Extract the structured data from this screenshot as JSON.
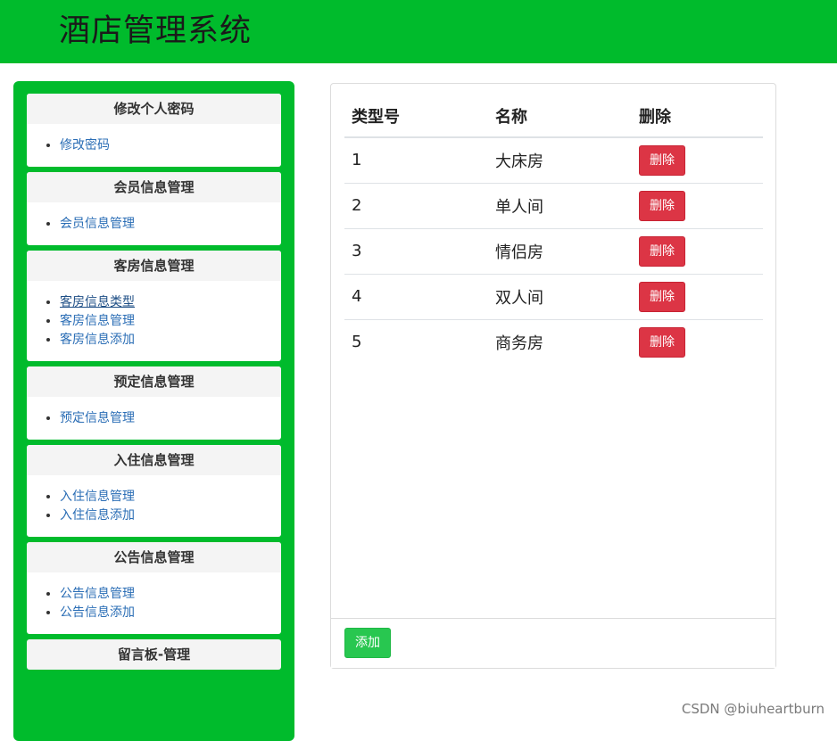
{
  "header": {
    "title": "酒店管理系统"
  },
  "sidebar": {
    "panels": [
      {
        "title": "修改个人密码",
        "items": [
          "修改密码"
        ]
      },
      {
        "title": "会员信息管理",
        "items": [
          "会员信息管理"
        ]
      },
      {
        "title": "客房信息管理",
        "items": [
          "客房信息类型",
          "客房信息管理",
          "客房信息添加"
        ]
      },
      {
        "title": "预定信息管理",
        "items": [
          "预定信息管理"
        ]
      },
      {
        "title": "入住信息管理",
        "items": [
          "入住信息管理",
          "入住信息添加"
        ]
      },
      {
        "title": "公告信息管理",
        "items": [
          "公告信息管理",
          "公告信息添加"
        ]
      },
      {
        "title": "留言板-管理",
        "items": []
      }
    ]
  },
  "table": {
    "headers": [
      "类型号",
      "名称",
      "删除"
    ],
    "rows": [
      {
        "id": "1",
        "name": "大床房",
        "action": "删除"
      },
      {
        "id": "2",
        "name": "单人间",
        "action": "删除"
      },
      {
        "id": "3",
        "name": "情侣房",
        "action": "删除"
      },
      {
        "id": "4",
        "name": "双人间",
        "action": "删除"
      },
      {
        "id": "5",
        "name": "商务房",
        "action": "删除"
      }
    ]
  },
  "footer": {
    "add_label": "添加"
  },
  "watermark": "CSDN @biuheartburn",
  "colors": {
    "brand_green": "#00bb2c",
    "danger_red": "#dc3545",
    "add_green": "#28c750",
    "link_blue": "#2a6db5"
  }
}
